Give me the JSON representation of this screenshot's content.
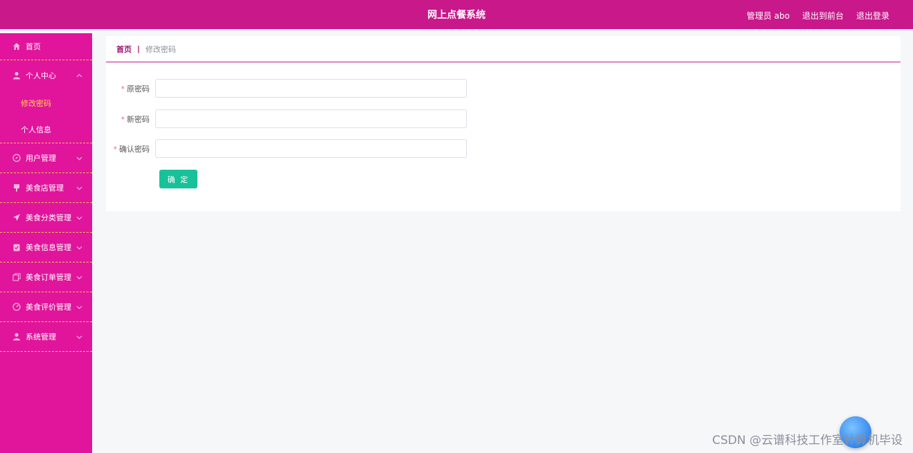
{
  "header": {
    "title": "网上点餐系统",
    "user_label": "管理员 abo",
    "front_label": "退出到前台",
    "logout_label": "退出登录"
  },
  "sidebar": {
    "items": [
      {
        "label": "首页",
        "icon": "home-icon"
      },
      {
        "label": "个人中心",
        "icon": "user-icon",
        "expanded": true,
        "children": [
          {
            "label": "修改密码",
            "active": true
          },
          {
            "label": "个人信息",
            "active": false
          }
        ]
      },
      {
        "label": "用户管理",
        "icon": "compass-icon"
      },
      {
        "label": "美食店管理",
        "icon": "flag-icon"
      },
      {
        "label": "美食分类管理",
        "icon": "send-icon"
      },
      {
        "label": "美食信息管理",
        "icon": "clipboard-icon"
      },
      {
        "label": "美食订单管理",
        "icon": "copy-icon"
      },
      {
        "label": "美食评价管理",
        "icon": "gauge-icon"
      },
      {
        "label": "系统管理",
        "icon": "user-icon"
      }
    ]
  },
  "breadcrumb": {
    "home": "首页",
    "separator": "|",
    "current": "修改密码"
  },
  "form": {
    "required_mark": "*",
    "old_password_label": "原密码",
    "old_password_value": "",
    "new_password_label": "新密码",
    "new_password_value": "",
    "confirm_password_label": "确认密码",
    "confirm_password_value": "",
    "submit_label": "确 定"
  },
  "watermark": "CSDN @云谱科技工作室计算机毕设",
  "colors": {
    "header_bg": "#c8188a",
    "sidebar_bg": "#e0159c",
    "active_sub": "#ffd24a",
    "submit_bg": "#19c19a"
  }
}
